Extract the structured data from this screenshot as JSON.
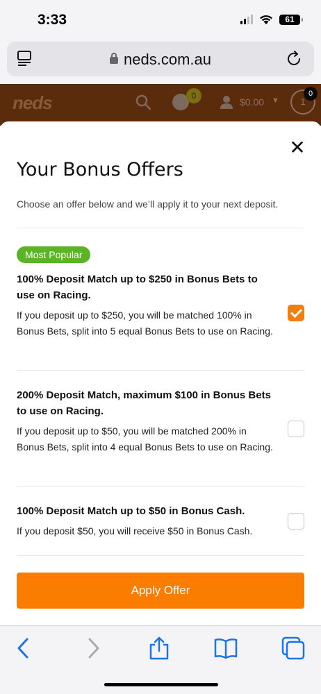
{
  "status_bar": {
    "time": "3:33",
    "battery": "61"
  },
  "browser": {
    "url": "neds.com.au"
  },
  "site_header": {
    "logo": "neds",
    "promo_count": "0",
    "balance": "$0.00",
    "betslip_count": "1",
    "betslip_badge": "0"
  },
  "modal": {
    "title": "Your Bonus Offers",
    "subtitle": "Choose an offer below and we’ll apply it to your next deposit.",
    "badge": "Most Popular",
    "offers": [
      {
        "title": "100% Deposit Match up to $250 in Bonus Bets to use on Racing.",
        "description": "If you deposit up to $250, you will be matched 100% in Bonus Bets, split into 5 equal Bonus Bets to use on Racing.",
        "selected": true
      },
      {
        "title": "200% Deposit Match, maximum $100 in Bonus Bets to use on Racing.",
        "description": "If you deposit up to $50, you will be matched 200% in Bonus Bets, split into 4 equal Bonus Bets to use on Racing.",
        "selected": false
      },
      {
        "title": "100% Deposit Match up to $50 in Bonus Cash.",
        "description": "If you deposit $50, you will receive $50 in Bonus Cash.",
        "selected": false
      }
    ],
    "apply_label": "Apply Offer",
    "close_icon": "close-icon"
  },
  "colors": {
    "accent": "#fb7d00",
    "checkbox_checked": "#f07f0f",
    "badge": "#5ab524",
    "header_bg": "#5a2c0c",
    "safari_blue": "#1a73e8"
  },
  "toolbar_icons": [
    "back-icon",
    "forward-icon",
    "share-icon",
    "bookmarks-icon",
    "tabs-icon"
  ]
}
